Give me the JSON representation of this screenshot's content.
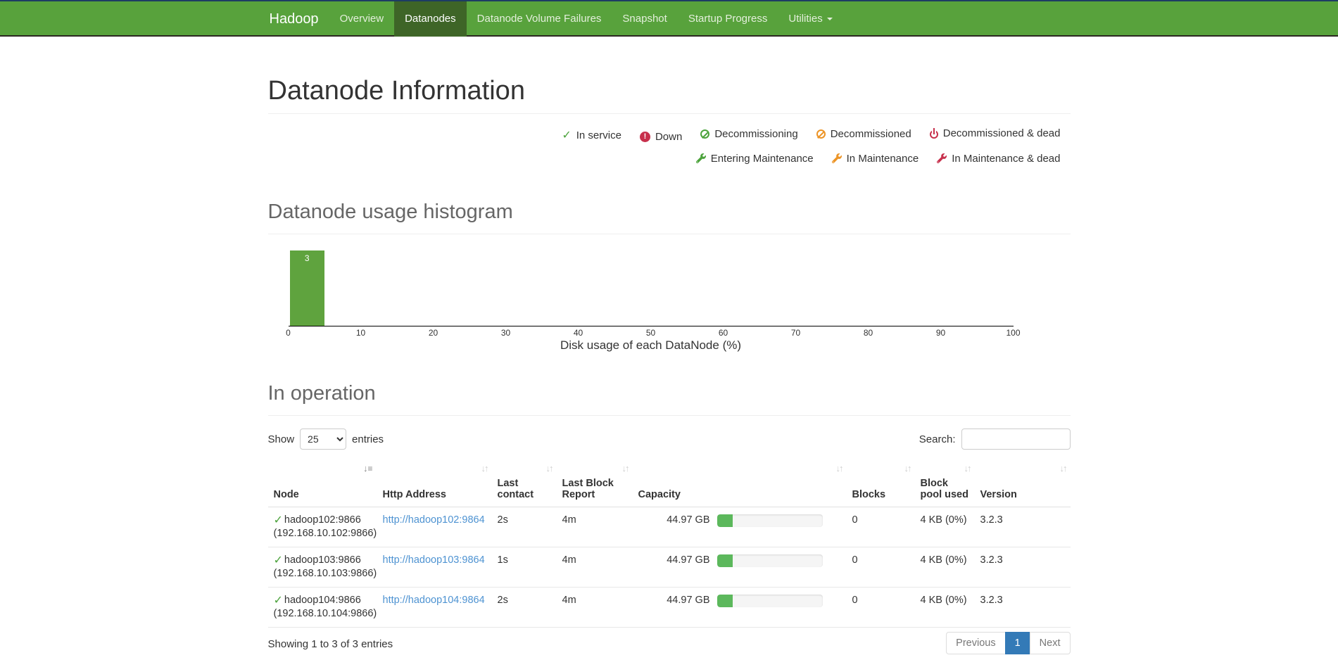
{
  "navbar": {
    "brand": "Hadoop",
    "items": [
      {
        "label": "Overview",
        "active": false
      },
      {
        "label": "Datanodes",
        "active": true
      },
      {
        "label": "Datanode Volume Failures",
        "active": false
      },
      {
        "label": "Snapshot",
        "active": false
      },
      {
        "label": "Startup Progress",
        "active": false
      },
      {
        "label": "Utilities",
        "active": false,
        "dropdown": true
      }
    ]
  },
  "page": {
    "title": "Datanode Information"
  },
  "legend": {
    "rows": [
      [
        {
          "icon": "check",
          "color": "#4ca33c",
          "label": "In service"
        },
        {
          "icon": "excl",
          "color": "#c7304c",
          "label": "Down"
        },
        {
          "icon": "ban",
          "color": "#4ca33c",
          "label": "Decommissioning"
        },
        {
          "icon": "ban",
          "color": "#ec9426",
          "label": "Decommissioned"
        },
        {
          "icon": "power",
          "color": "#c7304c",
          "label": "Decommissioned & dead"
        }
      ],
      [
        {
          "icon": "wrench",
          "color": "#4ca33c",
          "label": "Entering Maintenance"
        },
        {
          "icon": "wrench",
          "color": "#ec9426",
          "label": "In Maintenance"
        },
        {
          "icon": "wrench",
          "color": "#c7304c",
          "label": "In Maintenance & dead"
        }
      ]
    ]
  },
  "sections": {
    "histogram_title": "Datanode usage histogram",
    "operation_title": "In operation"
  },
  "chart_data": {
    "type": "bar",
    "title": "Datanode usage histogram",
    "xlabel": "Disk usage of each DataNode (%)",
    "ylabel": "",
    "xlim": [
      0,
      100
    ],
    "ylim": [
      0,
      3
    ],
    "x_ticks": [
      0,
      10,
      20,
      30,
      40,
      50,
      60,
      70,
      80,
      90,
      100
    ],
    "bars": [
      {
        "x0": 0,
        "x1": 5,
        "count": 3,
        "label": "3"
      }
    ],
    "bar_color": "#5fa33e",
    "grid": false,
    "legend_position": "none"
  },
  "table": {
    "show_label": "Show",
    "entries_label": "entries",
    "page_size": "25",
    "page_size_options": [
      "25"
    ],
    "search_label": "Search:",
    "search_value": "",
    "columns": [
      {
        "label": "Node",
        "sort": "asc"
      },
      {
        "label": "Http Address",
        "sort": "both"
      },
      {
        "label": "Last contact",
        "sort": "both"
      },
      {
        "label": "Last Block Report",
        "sort": "both"
      },
      {
        "label": "Capacity",
        "sort": "both"
      },
      {
        "label": "Blocks",
        "sort": "both"
      },
      {
        "label": "Block pool used",
        "sort": "both"
      },
      {
        "label": "Version",
        "sort": "both"
      }
    ],
    "rows": [
      {
        "status": "in-service",
        "node": "hadoop102:9866",
        "ip": "(192.168.10.102:9866)",
        "http": "http://hadoop102:9864",
        "contact": "2s",
        "lbr": "4m",
        "capacity": "44.97 GB",
        "capacity_pct": 15,
        "blocks": "0",
        "bpu": "4 KB (0%)",
        "version": "3.2.3"
      },
      {
        "status": "in-service",
        "node": "hadoop103:9866",
        "ip": "(192.168.10.103:9866)",
        "http": "http://hadoop103:9864",
        "contact": "1s",
        "lbr": "4m",
        "capacity": "44.97 GB",
        "capacity_pct": 15,
        "blocks": "0",
        "bpu": "4 KB (0%)",
        "version": "3.2.3"
      },
      {
        "status": "in-service",
        "node": "hadoop104:9866",
        "ip": "(192.168.10.104:9866)",
        "http": "http://hadoop104:9864",
        "contact": "2s",
        "lbr": "4m",
        "capacity": "44.97 GB",
        "capacity_pct": 15,
        "blocks": "0",
        "bpu": "4 KB (0%)",
        "version": "3.2.3"
      }
    ],
    "footer": "Showing 1 to 3 of 3 entries",
    "pagination": {
      "previous": "Previous",
      "page": "1",
      "next": "Next",
      "active_page": "1"
    }
  },
  "colors": {
    "navbar_green": "#58a23c",
    "navbar_active_green": "#3e6527",
    "link_blue": "#4e93d2",
    "pagination_active_blue": "#337ab7",
    "histogram_bar_green": "#5fa33e",
    "progress_fill_green": "#5cb85c",
    "status_ok_green": "#4ca33c",
    "status_warn_orange": "#ec9426",
    "status_danger_red": "#c7304c"
  }
}
